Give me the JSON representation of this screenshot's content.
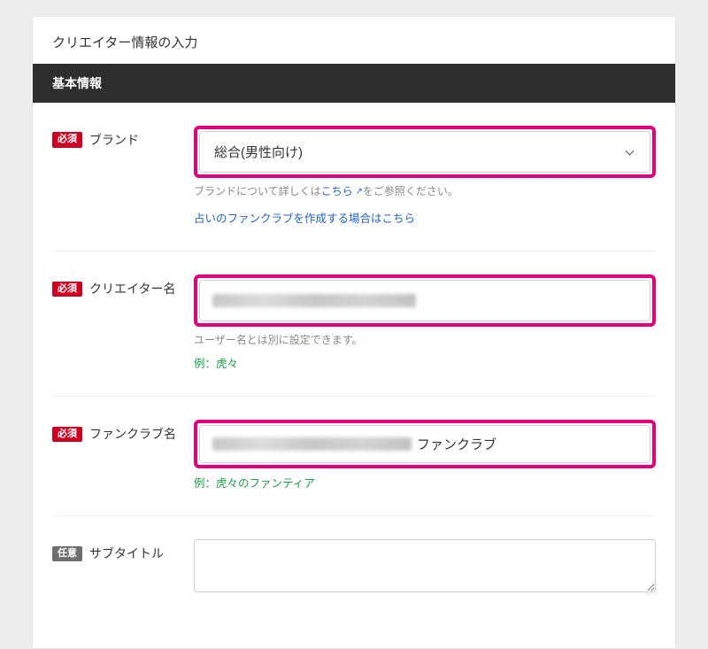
{
  "page": {
    "title": "クリエイター情報の入力"
  },
  "section": {
    "basic_info": "基本情報"
  },
  "badges": {
    "required": "必須",
    "optional": "任意"
  },
  "fields": {
    "brand": {
      "label": "ブランド",
      "selected": "総合(男性向け)",
      "helper_prefix": "ブランドについて詳しくは",
      "helper_link": "こちら",
      "helper_suffix": "をご参照ください。",
      "fortune_link": "占いのファンクラブを作成する場合はこちら"
    },
    "creator_name": {
      "label": "クリエイター名",
      "helper": "ユーザー名とは別に設定できます。",
      "example": "例：虎々"
    },
    "fanclub_name": {
      "label": "ファンクラブ名",
      "suffix": "ファンクラブ",
      "example": "例：虎々のファンティア"
    },
    "subtitle": {
      "label": "サブタイトル"
    }
  }
}
